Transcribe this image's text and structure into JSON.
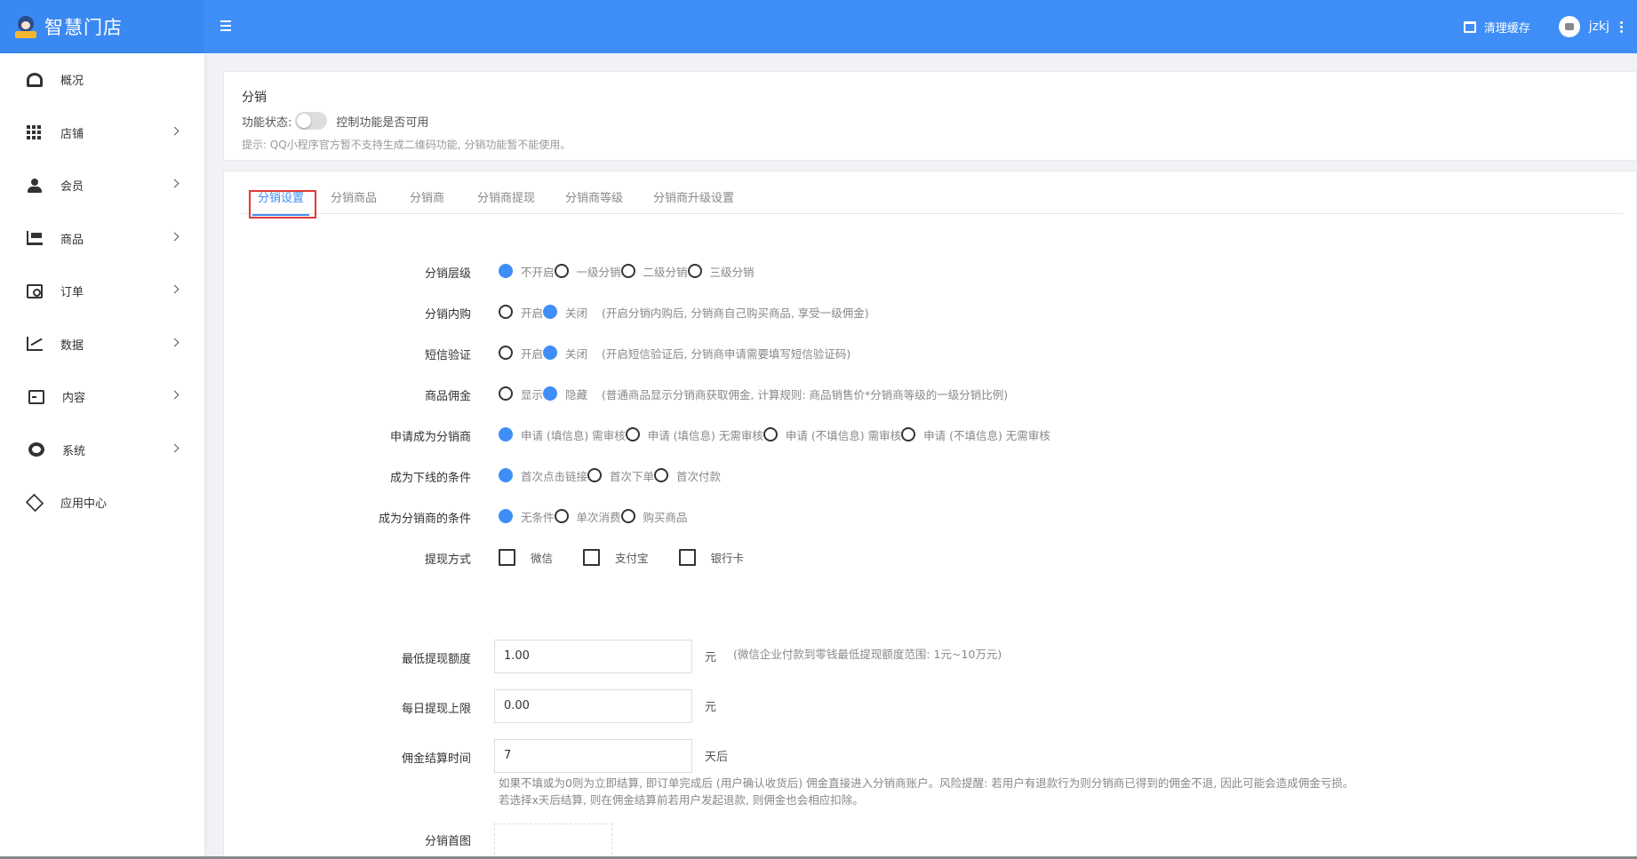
{
  "app": {
    "title": "智慧门店"
  },
  "header": {
    "clear_cache": "清理缓存",
    "username": "jzkj"
  },
  "sidebar": {
    "items": [
      {
        "label": "概况",
        "icon": "dashboard-icon",
        "has_children": false
      },
      {
        "label": "店铺",
        "icon": "grid-icon",
        "has_children": true
      },
      {
        "label": "会员",
        "icon": "users-icon",
        "has_children": true
      },
      {
        "label": "商品",
        "icon": "cart-icon",
        "has_children": true
      },
      {
        "label": "订单",
        "icon": "money-icon",
        "has_children": true
      },
      {
        "label": "数据",
        "icon": "chart-icon",
        "has_children": true
      },
      {
        "label": "内容",
        "icon": "document-icon",
        "has_children": true
      },
      {
        "label": "系统",
        "icon": "gear-icon",
        "has_children": true
      },
      {
        "label": "应用中心",
        "icon": "cube-icon",
        "has_children": false
      }
    ]
  },
  "intro": {
    "title": "分销",
    "status_label": "功能状态:",
    "status_enabled": false,
    "status_desc": "控制功能是否可用",
    "tip": "提示: QQ小程序官方暂不支持生成二维码功能, 分销功能暂不能使用。"
  },
  "tabs": [
    {
      "label": "分销设置",
      "active": true
    },
    {
      "label": "分销商品",
      "active": false
    },
    {
      "label": "分销商",
      "active": false
    },
    {
      "label": "分销商提现",
      "active": false
    },
    {
      "label": "分销商等级",
      "active": false
    },
    {
      "label": "分销商升级设置",
      "active": false
    }
  ],
  "form": {
    "level": {
      "label": "分销层级",
      "options": [
        "不开启",
        "一级分销",
        "二级分销",
        "三级分销"
      ],
      "selected": 0
    },
    "self_buy": {
      "label": "分销内购",
      "options": [
        "开启",
        "关闭"
      ],
      "selected": 1,
      "note": "(开启分销内购后, 分销商自己购买商品, 享受一级佣金)"
    },
    "sms": {
      "label": "短信验证",
      "options": [
        "开启",
        "关闭"
      ],
      "selected": 1,
      "note": "(开启短信验证后, 分销商申请需要填写短信验证码)"
    },
    "commission": {
      "label": "商品佣金",
      "options": [
        "显示",
        "隐藏"
      ],
      "selected": 1,
      "note": "(普通商品显示分销商获取佣金, 计算规则: 商品销售价*分销商等级的一级分销比例)"
    },
    "apply": {
      "label": "申请成为分销商",
      "options": [
        "申请 (填信息) 需审核",
        "申请 (填信息) 无需审核",
        "申请 (不填信息) 需审核",
        "申请 (不填信息) 无需审核"
      ],
      "selected": 0
    },
    "downline": {
      "label": "成为下线的条件",
      "options": [
        "首次点击链接",
        "首次下单",
        "首次付款"
      ],
      "selected": 0
    },
    "become": {
      "label": "成为分销商的条件",
      "options": [
        "无条件",
        "单次消费",
        "购买商品"
      ],
      "selected": 0
    },
    "withdraw": {
      "label": "提现方式",
      "options": [
        "微信",
        "支付宝",
        "银行卡"
      ]
    },
    "min_withdraw": {
      "label": "最低提现额度",
      "value": "1.00",
      "unit": "元",
      "note": "(微信企业付款到零钱最低提现额度范围: 1元~10万元)"
    },
    "daily_limit": {
      "label": "每日提现上限",
      "value": "0.00",
      "unit": "元"
    },
    "settle_time": {
      "label": "佣金结算时间",
      "value": "7",
      "unit": "天后",
      "help1": "如果不填或为0则为立即结算, 即订单完成后 (用户确认收货后) 佣金直接进入分销商账户。风险提醒: 若用户有退款行为则分销商已得到的佣金不退, 因此可能会造成佣金亏损。",
      "help2": "若选择x天后结算, 则在佣金结算前若用户发起退款, 则佣金也会相应扣除。"
    },
    "poster": {
      "label": "分销首图"
    }
  }
}
